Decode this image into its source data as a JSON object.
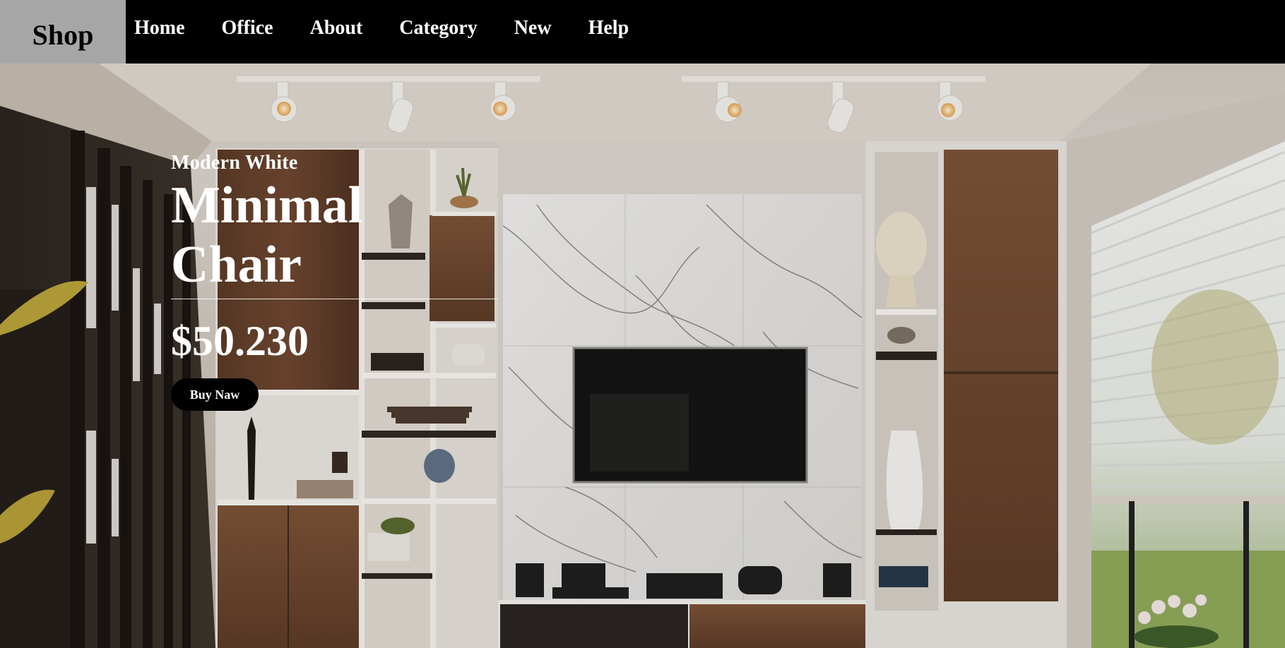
{
  "brand": "Shop",
  "nav": [
    "Home",
    "Office",
    "About",
    "Category",
    "New",
    "Help"
  ],
  "hero": {
    "kicker": "Modern White",
    "title_line1": "Minimal",
    "title_line2": "Chair",
    "price": "$50.230",
    "cta": "Buy Naw"
  },
  "colors": {
    "navbar_bg": "#000000",
    "brand_bg": "#a6a6a6",
    "button_bg": "#000000",
    "hero_text": "#ffffff"
  }
}
